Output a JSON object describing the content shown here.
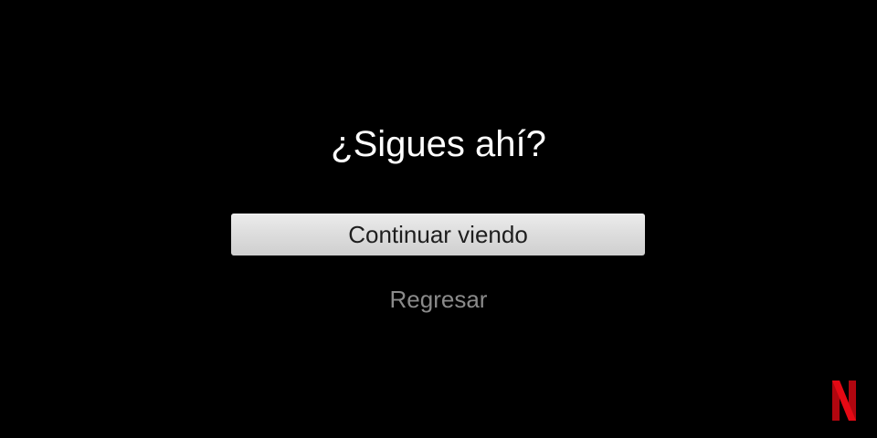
{
  "dialog": {
    "title": "¿Sigues ahí?",
    "continue_label": "Continuar viendo",
    "back_label": "Regresar"
  },
  "brand": {
    "logo_icon": "netflix-n-logo",
    "logo_text": "N",
    "accent": "#e50914"
  },
  "colors": {
    "background": "#000000",
    "title_text": "#ffffff",
    "button_bg": "#dedede",
    "button_text": "#1e1e1e",
    "link_text": "#8a8a8a"
  }
}
